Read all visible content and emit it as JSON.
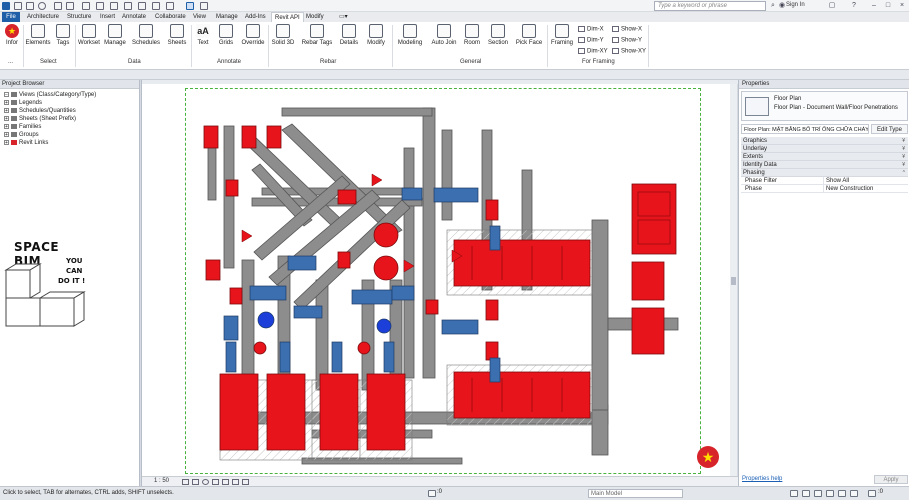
{
  "titlebar": {
    "search_placeholder": "Type a keyword or phrase",
    "signin": "Sign In"
  },
  "tabs": [
    "File",
    "Architecture",
    "Structure",
    "Insert",
    "Annotate",
    "Collaborate",
    "View",
    "Manage",
    "Add-Ins",
    "Revit API",
    "Modify"
  ],
  "active_tab": "Revit API",
  "ribbon": {
    "buttons": {
      "infor": "Infor",
      "elements": "Elements",
      "tags": "Tags",
      "workset": "Workset",
      "manage": "Manage",
      "schedules": "Schedules",
      "sheets": "Sheets",
      "text": "Text",
      "grids": "Grids",
      "override": "Override",
      "solid3d": "Solid 3D",
      "rebar_tags": "Rebar Tags",
      "details": "Details",
      "modify": "Modify",
      "modeling": "Modeling",
      "auto_join": "Auto Join",
      "room": "Room",
      "section": "Section",
      "pick_face": "Pick Face",
      "framing": "Framing",
      "dim_x": "Dim-X",
      "dim_y": "Dim-Y",
      "dim_xy": "Dim-XY",
      "show_x": "Show-X",
      "show_y": "Show-Y",
      "show_xy": "Show-XY"
    },
    "panels": {
      "dots": "...",
      "select": "Select",
      "data": "Data",
      "annotate": "Annotate",
      "rebar": "Rebar",
      "general": "General",
      "for_framing": "For Framing"
    }
  },
  "project_browser": {
    "title": "Project Browser",
    "items": [
      "Views (Class/Category/Type)",
      "Legends",
      "Schedules/Quantities",
      "Sheets (Sheet Prefix)",
      "Families",
      "Groups",
      "Revit Links"
    ]
  },
  "logo": {
    "title": "SPACE BIM",
    "line1": "YOU",
    "line2": "CAN",
    "line3": "DO IT !"
  },
  "canvas": {
    "scale": "1 : 50"
  },
  "properties": {
    "title": "Properties",
    "type_name": "Floor Plan",
    "type_desc": "Floor Plan - Document Wall/Floor Penetrations",
    "instance_select": "Floor Plan: MẶT BẰNG BỐ TRÍ ỐNG CHỮA CHÁY",
    "edit_type": "Edit Type",
    "groups": [
      "Graphics",
      "Underlay",
      "Extents",
      "Identity Data",
      "Phasing"
    ],
    "rows": [
      {
        "key": "Phase Filter",
        "value": "Show All"
      },
      {
        "key": "Phase",
        "value": "New Construction"
      }
    ],
    "help": "Properties help",
    "apply": "Apply"
  },
  "statusbar": {
    "hint": "Click to select, TAB for alternates, CTRL adds, SHIFT unselects.",
    "zero": ":0",
    "model": "Main Model"
  },
  "colors": {
    "fire_red": "#e8141b",
    "pipe_grey": "#8a8a8a",
    "valve_blue": "#3b6fb0",
    "file_tab": "#1f5fa8",
    "crop_green": "#47b33e"
  }
}
